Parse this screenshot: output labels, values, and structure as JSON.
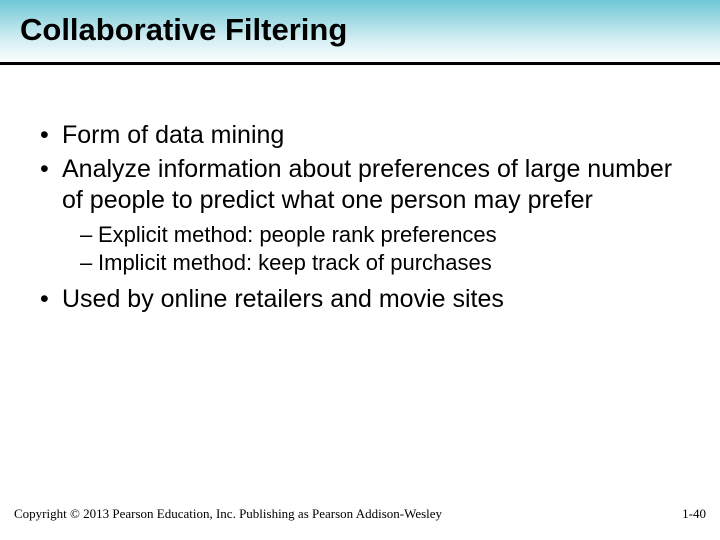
{
  "title": "Collaborative Filtering",
  "bullets": {
    "b1": "Form of data mining",
    "b2": "Analyze information about preferences of large number of people to predict what one person may prefer",
    "b2_sub1": "Explicit method: people rank preferences",
    "b2_sub2": "Implicit method: keep track of purchases",
    "b3": "Used by online retailers and movie sites"
  },
  "footer": {
    "copyright": "Copyright © 2013 Pearson Education, Inc. Publishing as Pearson Addison-Wesley",
    "page": "1-40"
  }
}
